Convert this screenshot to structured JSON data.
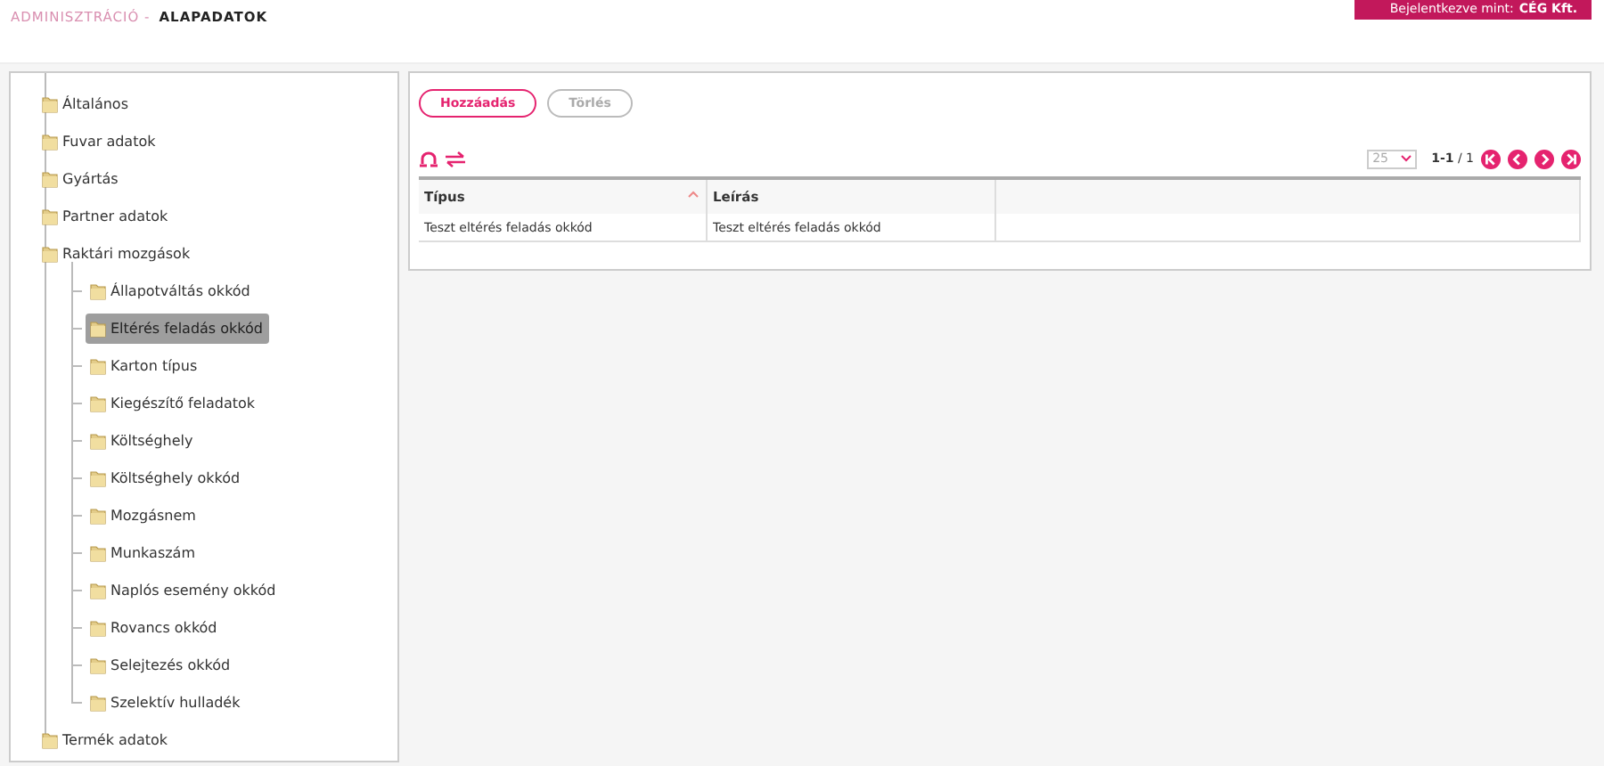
{
  "breadcrumb": {
    "parent": "ADMINISZTRÁCIÓ -",
    "current": "ALAPADATOK"
  },
  "login": {
    "label": "Bejelentkezve mint:",
    "user": "CÉG Kft."
  },
  "tree": [
    {
      "label": "Általános",
      "selected": false
    },
    {
      "label": "Fuvar adatok",
      "selected": false
    },
    {
      "label": "Gyártás",
      "selected": false
    },
    {
      "label": "Partner adatok",
      "selected": false
    },
    {
      "label": "Raktári mozgások",
      "selected": false,
      "children": [
        {
          "label": "Állapotváltás okkód",
          "selected": false
        },
        {
          "label": "Eltérés feladás okkód",
          "selected": true
        },
        {
          "label": "Karton típus",
          "selected": false
        },
        {
          "label": "Kiegészítő feladatok",
          "selected": false
        },
        {
          "label": "Költséghely",
          "selected": false
        },
        {
          "label": "Költséghely okkód",
          "selected": false
        },
        {
          "label": "Mozgásnem",
          "selected": false
        },
        {
          "label": "Munkaszám",
          "selected": false
        },
        {
          "label": "Naplós esemény okkód",
          "selected": false
        },
        {
          "label": "Rovancs okkód",
          "selected": false
        },
        {
          "label": "Selejtezés okkód",
          "selected": false
        },
        {
          "label": "Szelektív hulladék",
          "selected": false
        }
      ]
    },
    {
      "label": "Termék adatok",
      "selected": false
    }
  ],
  "buttons": [
    {
      "label": "Hozzáadás",
      "disabled": false
    },
    {
      "label": "Törlés",
      "disabled": true
    }
  ],
  "pager": {
    "page_size": "25",
    "info": "**1-1** / 1"
  },
  "table": {
    "columns": [
      {
        "label": "Típus",
        "sorted": true
      },
      {
        "label": "Leírás",
        "sorted": false
      }
    ],
    "rows": [
      [
        "Teszt eltérés feladás okkód",
        "Teszt eltérés feladás okkód"
      ]
    ]
  }
}
